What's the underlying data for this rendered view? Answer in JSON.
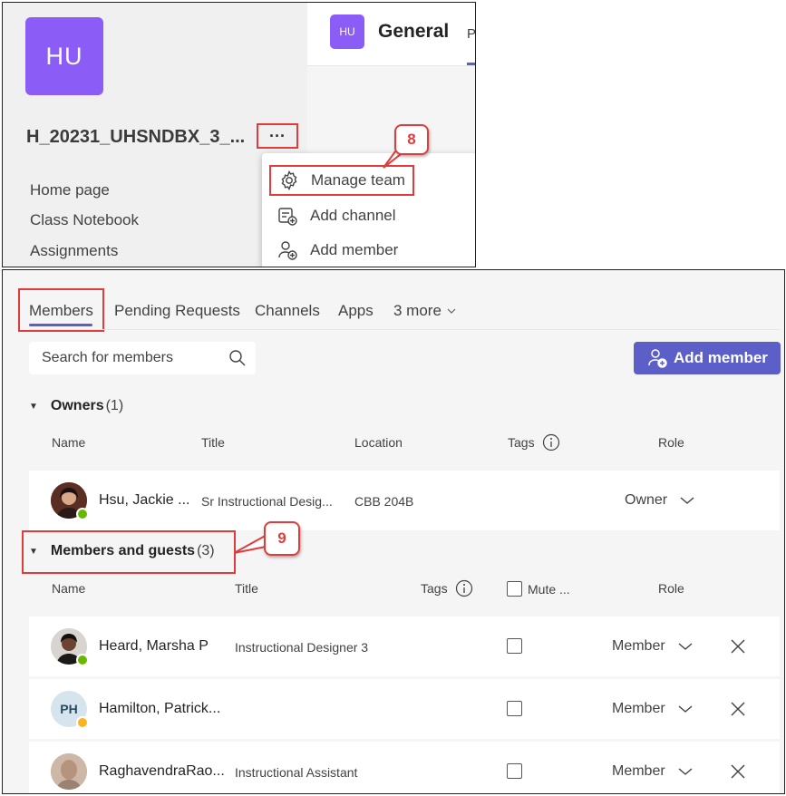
{
  "top": {
    "team_initials": "HU",
    "team_name": "H_20231_UHSNDBX_3_...",
    "more_options": "···",
    "nav": [
      "Home page",
      "Class Notebook",
      "Assignments"
    ],
    "channel": {
      "initials": "HU",
      "title": "General",
      "tab_fragment": "P"
    },
    "menu": [
      "Manage team",
      "Add channel",
      "Add member"
    ],
    "callout_step": "8"
  },
  "bottom": {
    "tabs": [
      "Members",
      "Pending Requests",
      "Channels",
      "Apps",
      "3 more"
    ],
    "search_placeholder": "Search for members",
    "add_member_label": "Add member",
    "owners": {
      "label": "Owners",
      "count": "(1)",
      "columns": {
        "name": "Name",
        "title": "Title",
        "location": "Location",
        "tags": "Tags",
        "role": "Role"
      },
      "rows": [
        {
          "name": "Hsu, Jackie ...",
          "title": "Sr Instructional Desig...",
          "location": "CBB 204B",
          "role": "Owner",
          "status": "available"
        }
      ]
    },
    "members": {
      "label": "Members and guests",
      "count": "(3)",
      "columns": {
        "name": "Name",
        "title": "Title",
        "tags": "Tags",
        "mute": "Mute ...",
        "role": "Role"
      },
      "rows": [
        {
          "name": "Heard, Marsha P",
          "title": "Instructional Designer 3",
          "role": "Member",
          "status": "available"
        },
        {
          "name": "Hamilton, Patrick...",
          "initials": "PH",
          "title": "",
          "role": "Member",
          "status": "away"
        },
        {
          "name": "RaghavendraRao...",
          "title": "Instructional Assistant",
          "role": "Member",
          "status": ""
        }
      ]
    },
    "callout_step": "9"
  },
  "colors": {
    "brand": "#5b5fc7",
    "team_avatar": "#8b5cf6",
    "highlight": "#e03c3c",
    "available": "#6bb700",
    "away": "#f8b422"
  }
}
